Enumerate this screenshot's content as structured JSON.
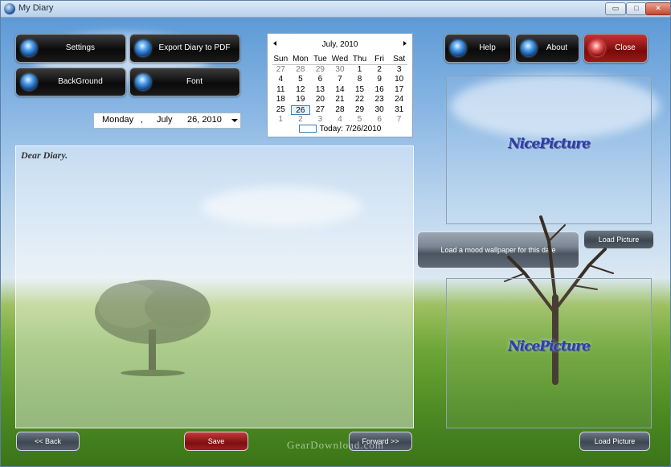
{
  "window": {
    "title": "My Diary",
    "controls": {
      "minimize": "▭",
      "maximize": "□",
      "close": "✕"
    }
  },
  "toolbar_left": {
    "settings": "Settings",
    "export": "Export Diary to PDF",
    "background": "BackGround",
    "font": "Font"
  },
  "toolbar_right": {
    "help": "Help",
    "about": "About",
    "close": "Close"
  },
  "date_picker": {
    "weekday": "Monday",
    "sep": ",",
    "month": "July",
    "day_year": "26, 2010"
  },
  "calendar": {
    "month_label": "July, 2010",
    "weekdays": [
      "Sun",
      "Mon",
      "Tue",
      "Wed",
      "Thu",
      "Fri",
      "Sat"
    ],
    "weeks": [
      [
        "27",
        "28",
        "29",
        "30",
        "1",
        "2",
        "3"
      ],
      [
        "4",
        "5",
        "6",
        "7",
        "8",
        "9",
        "10"
      ],
      [
        "11",
        "12",
        "13",
        "14",
        "15",
        "16",
        "17"
      ],
      [
        "18",
        "19",
        "20",
        "21",
        "22",
        "23",
        "24"
      ],
      [
        "25",
        "26",
        "27",
        "28",
        "29",
        "30",
        "31"
      ],
      [
        "1",
        "2",
        "3",
        "4",
        "5",
        "6",
        "7"
      ]
    ],
    "selected": "26",
    "today_label": "Today: 7/26/2010"
  },
  "diary": {
    "text": "Dear Diary."
  },
  "pictures": {
    "top_placeholder": "NicePicture",
    "bottom_placeholder": "NicePicture",
    "load_top": "Load Picture",
    "load_bottom": "Load Picture"
  },
  "mood_button": "Load a mood wallpaper for this date",
  "nav": {
    "back": "<< Back",
    "save": "Save",
    "forward": "Forward >>"
  },
  "watermark": "GearDownload.com",
  "colors": {
    "accent_blue": "#1b5fb0",
    "close_red": "#8a0b0b",
    "sky": "#8cb8e4",
    "grass": "#5a962a"
  }
}
